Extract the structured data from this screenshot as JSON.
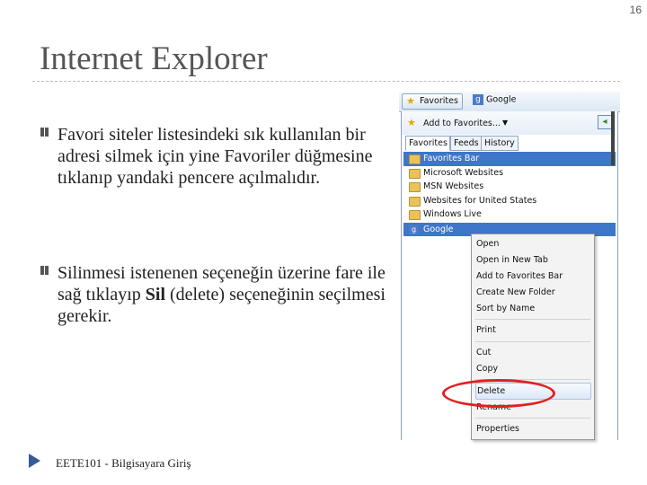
{
  "slide": {
    "number": "16",
    "title": "Internet Explorer",
    "bullets": [
      {
        "text": "Favori siteler listesindeki sık kullanılan bir adresi silmek için yine Favoriler düğmesine tıklanıp yandaki pencere açılmalıdır."
      },
      {
        "text_before": "Silinmesi istenenen seçeneğin üzerine fare ile sağ tıklayıp ",
        "bold": "Sil",
        "text_after": " (delete) seçeneğinin seçilmesi gerekir."
      }
    ],
    "footer": "EETE101 - Bilgisayara Giriş"
  },
  "browser": {
    "favorites_button": "Favorites",
    "favorites_icon": "star-icon",
    "tab_label": "Google",
    "tab_icon": "google-icon",
    "add_to_favorites": "Add to Favorites...",
    "tabs": [
      "Favorites",
      "Feeds",
      "History"
    ],
    "items": [
      {
        "label": "Favorites Bar",
        "icon": "folder-icon"
      },
      {
        "label": "Microsoft Websites",
        "icon": "folder-icon"
      },
      {
        "label": "MSN Websites",
        "icon": "folder-icon"
      },
      {
        "label": "Websites for United States",
        "icon": "folder-icon"
      },
      {
        "label": "Windows Live",
        "icon": "folder-icon"
      },
      {
        "label": "Google",
        "icon": "google-icon"
      }
    ]
  },
  "context_menu": {
    "items": [
      "Open",
      "Open in New Tab",
      "Add to Favorites Bar",
      "Create New Folder",
      "Sort by Name",
      "Print",
      "Cut",
      "Copy",
      "Delete",
      "Rename",
      "Properties"
    ]
  },
  "colors": {
    "selection": "#3e76c9",
    "highlight_circle": "#e02020",
    "footer_arrow": "#3b5998"
  }
}
